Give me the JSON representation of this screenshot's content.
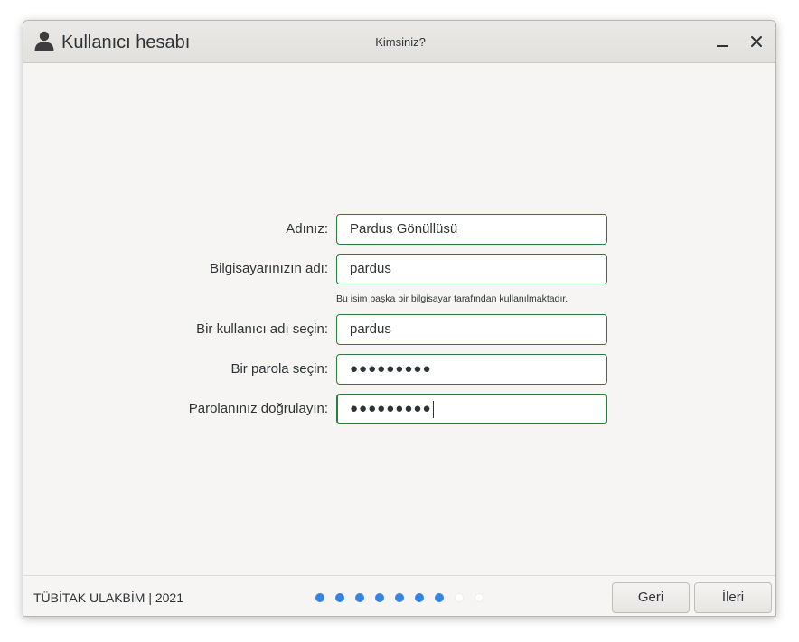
{
  "window": {
    "title": "Kullanıcı hesabı",
    "subtitle": "Kimsiniz?"
  },
  "form": {
    "name_label": "Adınız:",
    "name_value": "Pardus Gönüllüsü",
    "computer_label": "Bilgisayarınızın adı:",
    "computer_value": "pardus",
    "computer_hint": "Bu isim başka bir bilgisayar tarafından kullanılmaktadır.",
    "username_label": "Bir kullanıcı adı seçin:",
    "username_value": "pardus",
    "password_label": "Bir parola seçin:",
    "password_value": "●●●●●●●●●",
    "confirm_label": "Parolanınız doğrulayın:",
    "confirm_value": "●●●●●●●●●"
  },
  "footer": {
    "copyright": "TÜBİTAK ULAKBİM | 2021",
    "progress": {
      "total_steps": 9,
      "completed_steps": 7
    },
    "back_label": "Geri",
    "next_label": "İleri"
  },
  "colors": {
    "accent": "#2d7a3e",
    "step_active": "#3584e4",
    "step_inactive": "#ffffff"
  },
  "icons": {
    "app": "user-icon",
    "minimize": "minimize-icon",
    "close": "close-icon"
  }
}
